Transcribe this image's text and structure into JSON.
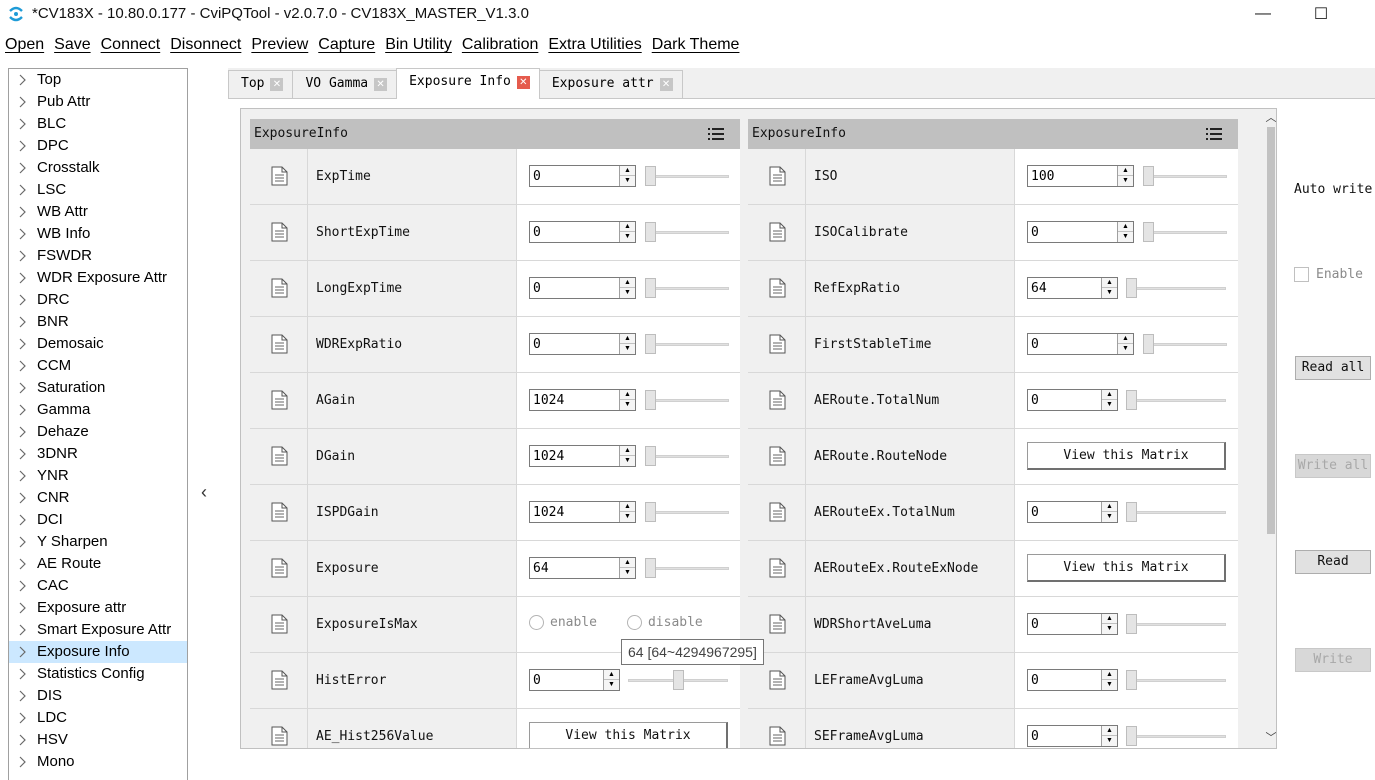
{
  "window": {
    "title": "*CV183X - 10.80.0.177 - CviPQTool - v2.0.7.0 - CV183X_MASTER_V1.3.0",
    "minimize": "—",
    "maximize": "☐"
  },
  "menu": [
    "Open",
    "Save",
    "Connect",
    "Disonnect",
    "Preview",
    "Capture",
    "Bin Utility",
    "Calibration",
    "Extra Utilities",
    "Dark Theme"
  ],
  "tree": {
    "selected": "Exposure Info",
    "items": [
      "Top",
      "Pub Attr",
      "BLC",
      "DPC",
      "Crosstalk",
      "LSC",
      "WB Attr",
      "WB Info",
      "FSWDR",
      "WDR Exposure Attr",
      "DRC",
      "BNR",
      "Demosaic",
      "CCM",
      "Saturation",
      "Gamma",
      "Dehaze",
      "3DNR",
      "YNR",
      "CNR",
      "DCI",
      "Y Sharpen",
      "AE Route",
      "CAC",
      "Exposure attr",
      "Smart Exposure Attr",
      "Exposure Info",
      "Statistics Config",
      "DIS",
      "LDC",
      "HSV",
      "Mono"
    ]
  },
  "collapse_arrow": "‹",
  "tabs": [
    {
      "label": "Top",
      "active": false
    },
    {
      "label": "VO Gamma",
      "active": false
    },
    {
      "label": "Exposure Info",
      "active": true
    },
    {
      "label": "Exposure attr",
      "active": false
    }
  ],
  "tab_close_glyph": "✕",
  "panels": [
    {
      "header": "ExposureInfo",
      "rows": [
        {
          "name": "ExpTime",
          "type": "spin",
          "value": "0",
          "slider_level": 0
        },
        {
          "name": "ShortExpTime",
          "type": "spin",
          "value": "0",
          "slider_level": 0
        },
        {
          "name": "LongExpTime",
          "type": "spin",
          "value": "0",
          "slider_level": 0
        },
        {
          "name": "WDRExpRatio",
          "type": "spin",
          "value": "0",
          "slider_level": 0
        },
        {
          "name": "AGain",
          "type": "spin",
          "value": "1024",
          "slider_level": 0
        },
        {
          "name": "DGain",
          "type": "spin",
          "value": "1024",
          "slider_level": 0
        },
        {
          "name": "ISPDGain",
          "type": "spin",
          "value": "1024",
          "slider_level": 0
        },
        {
          "name": "Exposure",
          "type": "spin",
          "value": "64",
          "slider_level": 0
        },
        {
          "name": "ExposureIsMax",
          "type": "radio",
          "options": [
            "enable",
            "disable"
          ]
        },
        {
          "name": "HistError",
          "type": "spin_small",
          "value": "0",
          "slider_level": 0.5
        },
        {
          "name": "AE_Hist256Value",
          "type": "matrix",
          "button": "View this Matrix"
        }
      ]
    },
    {
      "header": "ExposureInfo",
      "rows": [
        {
          "name": "ISO",
          "type": "spin",
          "value": "100",
          "slider_level": 0
        },
        {
          "name": "ISOCalibrate",
          "type": "spin",
          "value": "0",
          "slider_level": 0
        },
        {
          "name": "RefExpRatio",
          "type": "spin_small",
          "value": "64",
          "slider_level": 0
        },
        {
          "name": "FirstStableTime",
          "type": "spin",
          "value": "0",
          "slider_level": 0
        },
        {
          "name": "AERoute.TotalNum",
          "type": "spin_small",
          "value": "0",
          "slider_level": 0
        },
        {
          "name": "AERoute.RouteNode",
          "type": "matrix",
          "button": "View this Matrix"
        },
        {
          "name": "AERouteEx.TotalNum",
          "type": "spin_small",
          "value": "0",
          "slider_level": 0
        },
        {
          "name": "AERouteEx.RouteExNode",
          "type": "matrix",
          "button": "View this Matrix"
        },
        {
          "name": "WDRShortAveLuma",
          "type": "spin_small",
          "value": "0",
          "slider_level": 0
        },
        {
          "name": "LEFrameAvgLuma",
          "type": "spin_small",
          "value": "0",
          "slider_level": 0
        },
        {
          "name": "SEFrameAvgLuma",
          "type": "spin_small",
          "value": "0",
          "slider_level": 0
        }
      ]
    }
  ],
  "tooltip": "64 [64~4294967295]",
  "side": {
    "auto_write": "Auto write",
    "enable_label": "Enable",
    "read_all": "Read all",
    "write_all": "Write all",
    "read": "Read",
    "write": "Write"
  },
  "spin_up": "▲",
  "spin_down": "▼",
  "scroll_up": "︿",
  "scroll_down": "﹀"
}
